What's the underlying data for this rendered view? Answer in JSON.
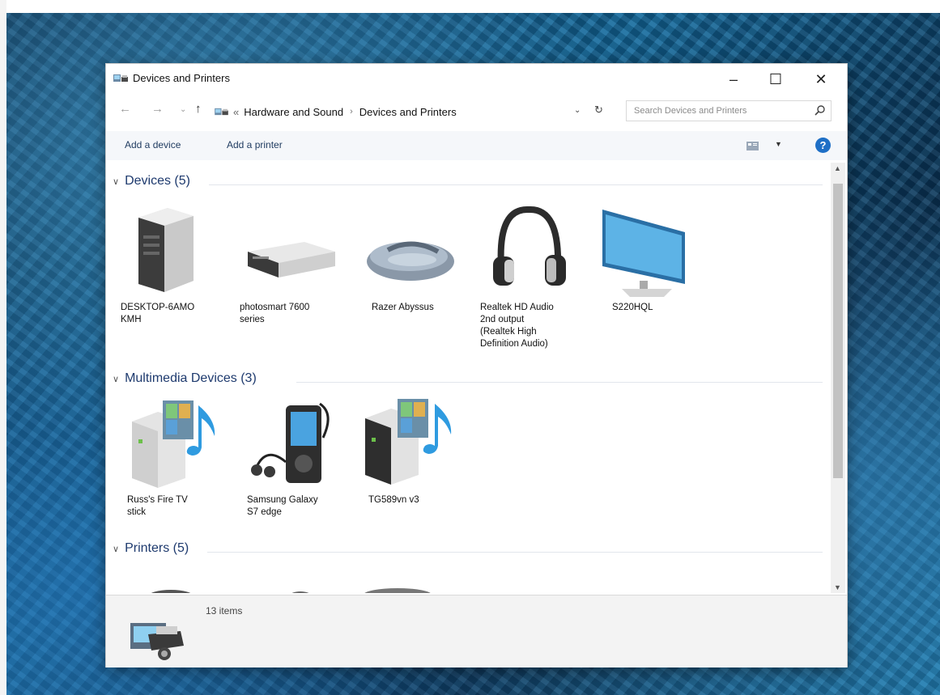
{
  "window": {
    "title": "Devices and Printers",
    "controls": {
      "minimize": "–",
      "maximize": "☐",
      "close": "✕"
    }
  },
  "address": {
    "overflow": "«",
    "breadcrumbs": [
      "Hardware and Sound",
      "Devices and Printers"
    ],
    "separator": "›"
  },
  "search": {
    "placeholder": "Search Devices and Printers"
  },
  "commands": {
    "add_device": "Add a device",
    "add_printer": "Add a printer",
    "help": "?"
  },
  "groups": {
    "devices": {
      "label": "Devices (5)",
      "items": [
        {
          "name": "DESKTOP-6AMO KMH",
          "line1": "DESKTOP-6AMO",
          "line2": "KMH",
          "icon": "computer-tower-icon"
        },
        {
          "name": "photosmart 7600 series",
          "line1": "photosmart 7600",
          "line2": "series",
          "icon": "external-drive-icon"
        },
        {
          "name": "Razer Abyssus",
          "line1": "Razer Abyssus",
          "icon": "mouse-icon"
        },
        {
          "name": "Realtek HD Audio 2nd output (Realtek High Definition Audio)",
          "line1": "Realtek HD Audio",
          "line2": "2nd output",
          "line3": "(Realtek High",
          "line4": "Definition Audio)",
          "icon": "headphones-icon"
        },
        {
          "name": "S220HQL",
          "line1": "S220HQL",
          "icon": "monitor-icon"
        }
      ]
    },
    "multimedia": {
      "label": "Multimedia Devices (3)",
      "items": [
        {
          "line1": "Russ's Fire TV",
          "line2": "stick",
          "icon": "media-server-icon"
        },
        {
          "line1": "Samsung Galaxy",
          "line2": "S7 edge",
          "icon": "media-player-icon"
        },
        {
          "line1": "TG589vn v3",
          "icon": "media-server-dark-icon"
        }
      ]
    },
    "printers": {
      "label": "Printers (5)"
    }
  },
  "status": {
    "count": "13 items"
  },
  "colors": {
    "accent": "#1e6fc6",
    "group_header": "#1e3a6e",
    "wallpaper": "#14689a"
  }
}
